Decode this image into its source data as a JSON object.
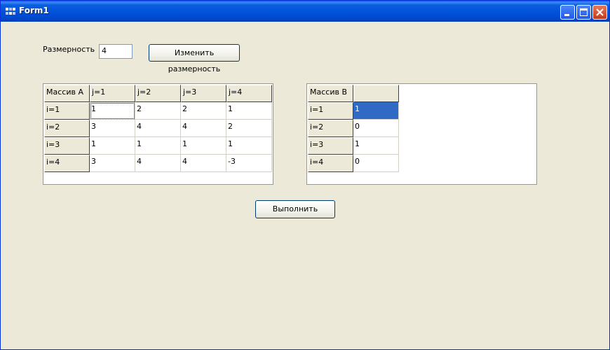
{
  "window": {
    "title": "Form1"
  },
  "dimension": {
    "label": "Размерность",
    "value": "4",
    "change_button": "Изменить размерность"
  },
  "grid_a": {
    "header": [
      "Массив A",
      "j=1",
      "j=2",
      "j=3",
      "j=4"
    ],
    "rows": [
      [
        "i=1",
        "1",
        "2",
        "2",
        "1"
      ],
      [
        "i=2",
        "3",
        "4",
        "4",
        "2"
      ],
      [
        "i=3",
        "1",
        "1",
        "1",
        "1"
      ],
      [
        "i=4",
        "3",
        "4",
        "4",
        "-3"
      ]
    ]
  },
  "grid_b": {
    "header": [
      "Массив  B",
      ""
    ],
    "rows": [
      [
        "i=1",
        "1"
      ],
      [
        "i=2",
        "0"
      ],
      [
        "i=3",
        "1"
      ],
      [
        "i=4",
        "0"
      ]
    ]
  },
  "run_button": "Выполнить",
  "colors": {
    "titlebar": "#0054e3",
    "face": "#ece9d8",
    "selection": "#316ac5",
    "close": "#c43a1b"
  },
  "icons": {
    "title_icon": "app-icon",
    "minimize": "minimize-icon",
    "maximize": "maximize-icon",
    "close": "close-icon"
  }
}
